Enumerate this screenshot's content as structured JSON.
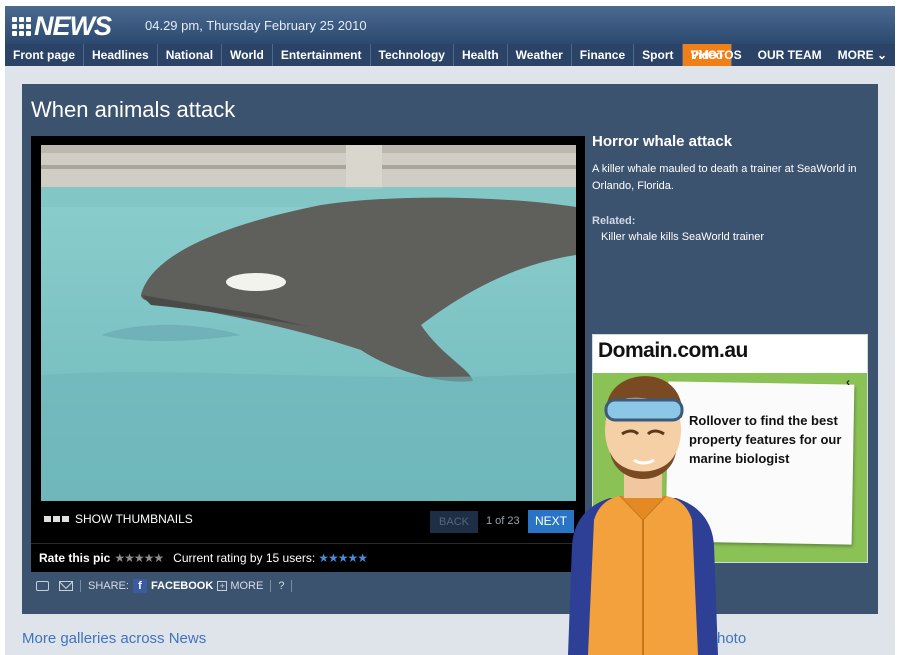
{
  "header": {
    "logo": "NEWS",
    "datestamp": "04.29 pm, Thursday February 25 2010"
  },
  "nav": {
    "items": [
      "Front page",
      "Headlines",
      "National",
      "World",
      "Entertainment",
      "Technology",
      "Health",
      "Weather",
      "Finance",
      "Sport",
      "Video"
    ],
    "active": "Video",
    "right_items": [
      "PHOTOS",
      "OUR TEAM",
      "MORE ⌄"
    ]
  },
  "gallery": {
    "title": "When animals attack",
    "show_thumbnails": "SHOW THUMBNAILS",
    "back": "BACK",
    "counter": "1 of 23",
    "next": "NEXT",
    "rate_label": "Rate this pic",
    "rate_stars": "★★★★★",
    "rating_text": "Current rating by 15 users:",
    "rating_stars": "★★★★★",
    "share_label": "SHARE:",
    "facebook": "FACEBOOK",
    "more": "MORE",
    "help": "?"
  },
  "caption": {
    "title": "Horror whale attack",
    "text": "A killer whale mauled to death a trainer at SeaWorld in Orlando, Florida.",
    "related_label": "Related:",
    "related_link": "Killer whale kills SeaWorld trainer"
  },
  "ad": {
    "brand": "Domain.com.au",
    "copy": "Rollover to find the best property features for our marine biologist",
    "close": "‹"
  },
  "footer": {
    "more_galleries": "More galleries across News",
    "photo_link": "hoto"
  },
  "colors": {
    "header_blue": "#2c4a70",
    "active_tab": "#f07f16",
    "panel": "#3c5370",
    "link": "#3f74bd",
    "next_button": "#2a74c5"
  }
}
